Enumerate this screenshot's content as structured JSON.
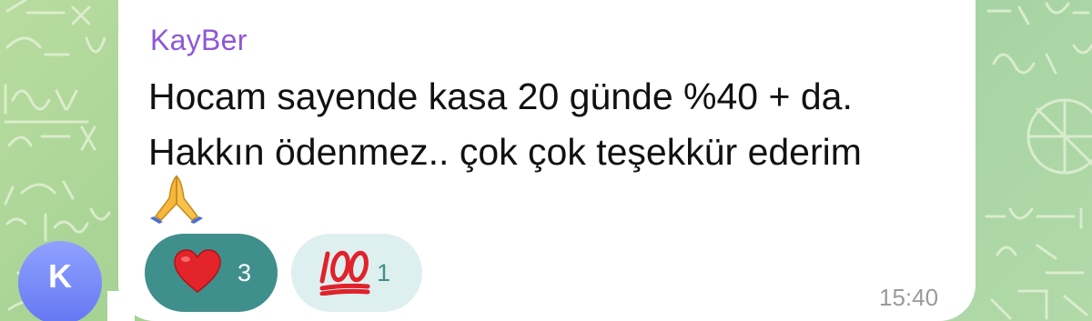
{
  "chat": {
    "sender_name": "KayBer",
    "avatar_letter": "K",
    "message_line1": "Hocam sayende kasa 20 günde %40 + da.",
    "message_line2": "Hakkın ödenmez.. çok çok teşekkür ederim",
    "message_emoji": "pray-icon",
    "timestamp": "15:40",
    "reactions": [
      {
        "icon": "heart-icon",
        "count": "3",
        "selected": true
      },
      {
        "icon": "hundred-points-icon",
        "count": "1",
        "selected": false
      }
    ]
  },
  "colors": {
    "sender_name": "#8e57d6",
    "reaction_selected_bg": "#3f8f8c",
    "reaction_unselected_bg": "#deeff0",
    "avatar": "#6f80f5",
    "wallpaper": "#a9d49a"
  }
}
